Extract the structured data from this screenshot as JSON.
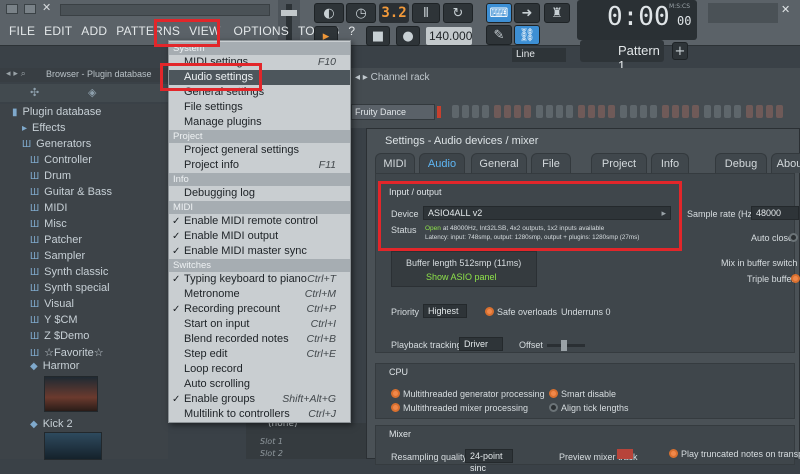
{
  "menubar": {
    "items": [
      "FILE",
      "EDIT",
      "ADD",
      "PATTERNS",
      "VIEW",
      "OPTIONS",
      "TOOLS",
      "?"
    ]
  },
  "toolbar": {
    "tempo": "140.000",
    "counter": "3.2",
    "pattern": "Pattern 1",
    "snap": "Line",
    "time_main": "0:00",
    "time_small": "00",
    "time_unit": "M:S:CS"
  },
  "browser": {
    "header": "Browser - Plugin database",
    "items": [
      "Plugin database",
      "Effects",
      "Generators",
      "Controller",
      "Drum",
      "Guitar & Bass",
      "MIDI",
      "Misc",
      "Patcher",
      "Sampler",
      "Synth classic",
      "Synth special",
      "Visual",
      "Y $CM",
      "Z $Demo",
      "☆Favorite☆",
      "Harmor",
      "Kick 2"
    ]
  },
  "channel_rack": {
    "title": "Channel rack",
    "channel": "Fruity Dance"
  },
  "bottom": {
    "none_label": "(none)",
    "slot1": "Slot 1",
    "slot2": "Slot 2"
  },
  "dropdown": {
    "sections": {
      "system": "System",
      "project": "Project",
      "info": "Info",
      "midi": "MIDI",
      "switches": "Switches"
    },
    "system_items": [
      {
        "label": "MIDI settings",
        "shortcut": "F10"
      },
      {
        "label": "Audio settings",
        "shortcut": ""
      },
      {
        "label": "General settings",
        "shortcut": ""
      },
      {
        "label": "File settings",
        "shortcut": ""
      },
      {
        "label": "Manage plugins",
        "shortcut": ""
      }
    ],
    "project_items": [
      {
        "label": "Project general settings",
        "shortcut": ""
      },
      {
        "label": "Project info",
        "shortcut": "F11"
      }
    ],
    "info_items": [
      {
        "label": "Debugging log",
        "shortcut": ""
      }
    ],
    "midi_items": [
      {
        "label": "Enable MIDI remote control",
        "checked": true
      },
      {
        "label": "Enable MIDI output",
        "checked": true
      },
      {
        "label": "Enable MIDI master sync",
        "checked": true
      }
    ],
    "switch_items": [
      {
        "label": "Typing keyboard to piano",
        "shortcut": "Ctrl+T",
        "checked": true
      },
      {
        "label": "Metronome",
        "shortcut": "Ctrl+M",
        "checked": false
      },
      {
        "label": "Recording precount",
        "shortcut": "Ctrl+P",
        "checked": true
      },
      {
        "label": "Start on input",
        "shortcut": "Ctrl+I",
        "checked": false
      },
      {
        "label": "Blend recorded notes",
        "shortcut": "Ctrl+B",
        "checked": false
      },
      {
        "label": "Step edit",
        "shortcut": "Ctrl+E",
        "checked": false
      },
      {
        "label": "Loop record",
        "shortcut": "",
        "checked": false
      },
      {
        "label": "Auto scrolling",
        "shortcut": "",
        "checked": false
      },
      {
        "label": "Enable groups",
        "shortcut": "Shift+Alt+G",
        "checked": true
      },
      {
        "label": "Multilink to controllers",
        "shortcut": "Ctrl+J",
        "checked": false
      }
    ]
  },
  "settings": {
    "title": "Settings - Audio devices / mixer",
    "tabs": [
      "MIDI",
      "Audio",
      "General",
      "File",
      "Project",
      "Info",
      "Debug",
      "About"
    ],
    "io_title": "Input / output",
    "device_label": "Device",
    "device_value": "ASIO4ALL v2",
    "status_label": "Status",
    "status_open": "Open",
    "status_line1": " at 48000Hz, Int32LSB, 4x2 outputs, 1x2 inputs available",
    "status_line2": "Latency: input: 748smp, output: 1280smp, output + plugins: 1280smp (27ms)",
    "sample_rate_label": "Sample rate (Hz)",
    "sample_rate_value": "48000",
    "auto_close": "Auto close",
    "buffer_length": "Buffer length 512smp (11ms)",
    "show_asio": "Show ASIO panel",
    "mix_buffer": "Mix in buffer switch",
    "triple_buffer": "Triple buffer",
    "priority_label": "Priority",
    "priority_value": "Highest",
    "safe_overloads": "Safe overloads",
    "underruns": "Underruns 0",
    "playback_label": "Playback tracking",
    "playback_value": "Driver",
    "offset_label": "Offset",
    "cpu_title": "CPU",
    "mt_gen": "Multithreaded generator processing",
    "mt_mix": "Multithreaded mixer processing",
    "smart_disable": "Smart disable",
    "align_ticks": "Align tick lengths",
    "mixer_title": "Mixer",
    "resampling": "Resampling quality",
    "resampling_value": "24-point sinc",
    "preview": "Preview mixer track",
    "truncated": "Play truncated notes on transport"
  },
  "colors": {
    "accent": "#3d8fd4",
    "highlight_red": "#e2262a",
    "orange": "#f39a3a"
  }
}
